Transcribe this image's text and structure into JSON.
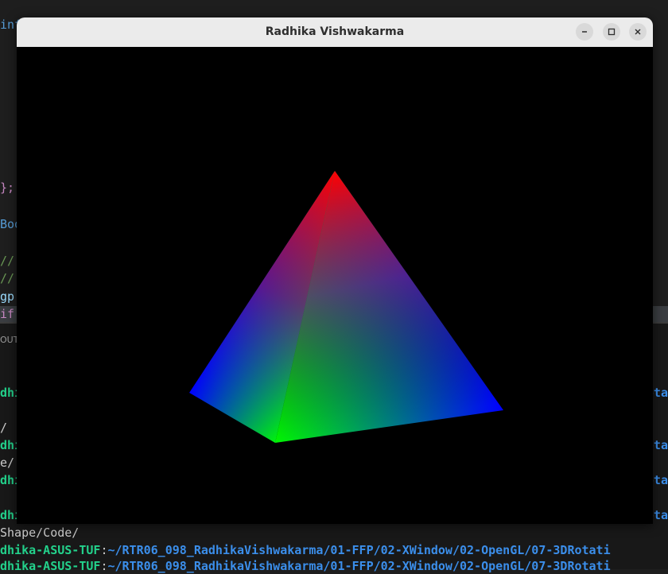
{
  "window": {
    "title": "Radhika Vishwakarma",
    "buttons": [
      "minimize-icon",
      "maximize-icon",
      "close-icon"
    ]
  },
  "scene": {
    "background": "#000000",
    "colors": {
      "apex": "#ff0000",
      "left": "#0000ff",
      "front": "#00ff00",
      "right": "#0000ff"
    }
  },
  "editor_fragments": {
    "l1": "inf",
    "l2": "};",
    "l3": "Boo",
    "l4": "//",
    "l5": "//",
    "l6": "gp",
    "l7": "if"
  },
  "panel": {
    "tab": "OUT"
  },
  "terminal": {
    "f1": "dhi",
    "f2": "/ (",
    "f3": "dhi",
    "f4": "e/(",
    "f5": "dhi",
    "f6": "dhi",
    "shape_code": "Shape/Code/",
    "user1": "dhika-ASUS-TUF",
    "path1": "~/RTR06_098_RadhikaVishwakarma/01-FFP/02-XWindow/02-OpenGL/07-3DRotati",
    "user2": "dhika-ASUS-TUF",
    "path2": "~/RTR06_098_RadhikaVishwakarma/01-FFP/02-XWindow/02-OpenGL/07-3DRotati",
    "right_frags": [
      "Rota",
      "Rota",
      "Rota",
      "Rota"
    ]
  }
}
